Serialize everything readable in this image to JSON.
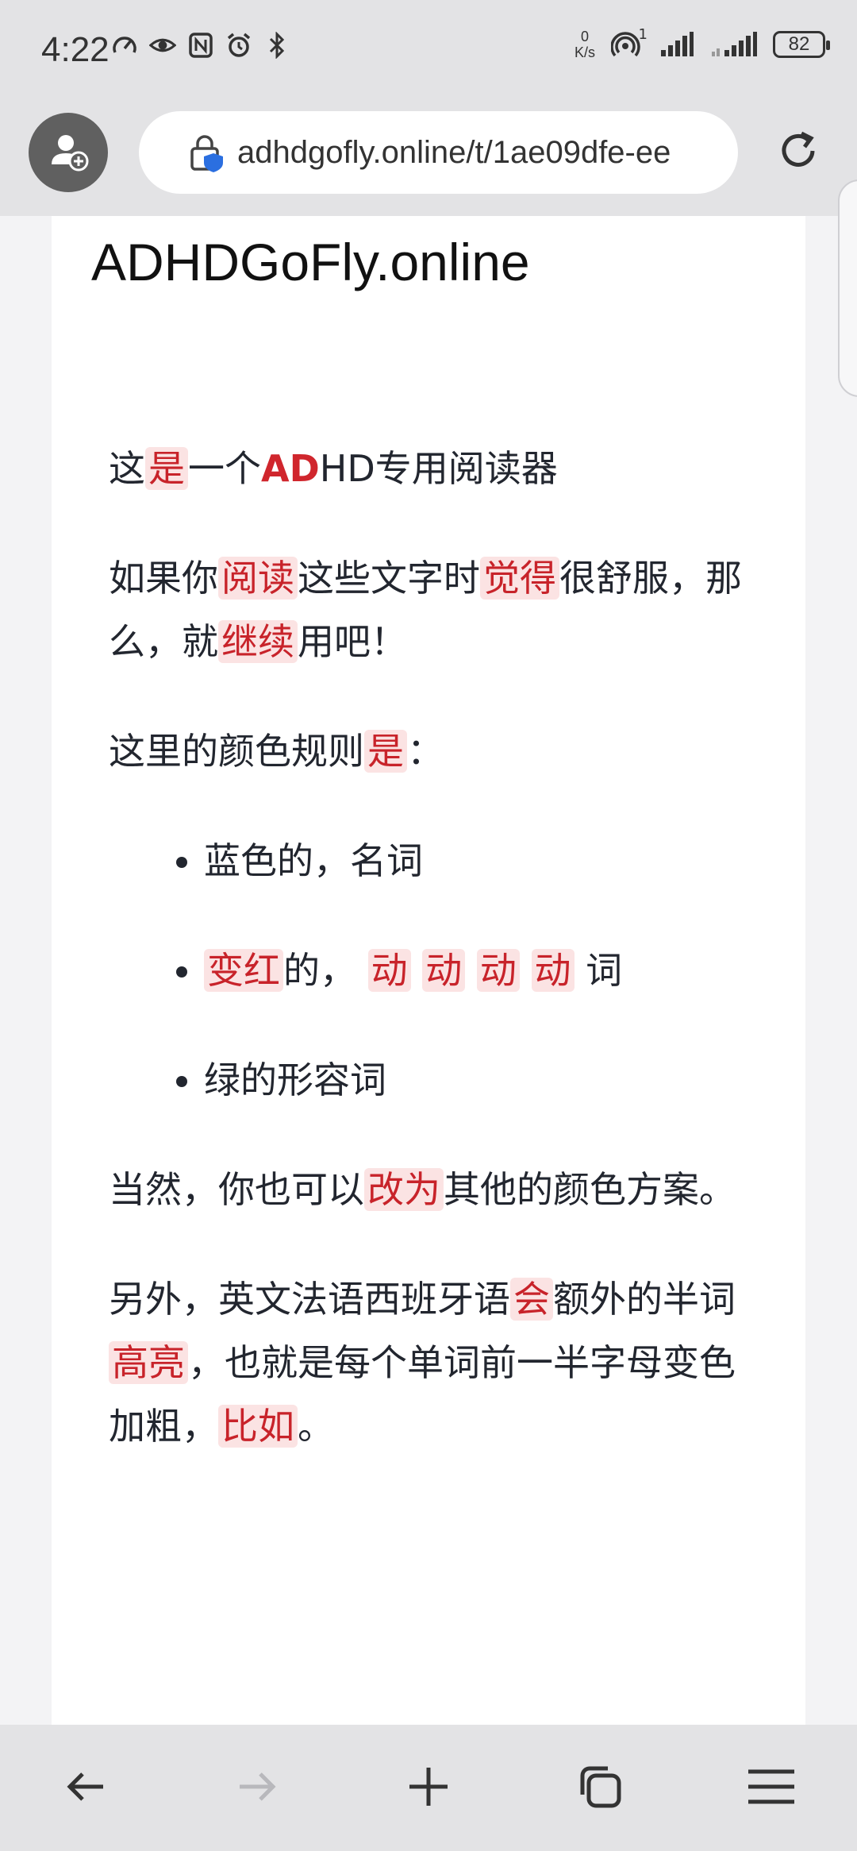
{
  "status_bar": {
    "time": "4:22",
    "net_speed_value": "0",
    "net_speed_unit": "K/s",
    "hotspot_badge": "1",
    "battery": "82"
  },
  "browser": {
    "url": "adhdgofly.online/t/1ae09dfe-ee"
  },
  "page": {
    "site_title": "ADHDGoFly.online",
    "p1": {
      "a": "这",
      "b": "是",
      "c": "一个",
      "d": "AD",
      "e": "HD专用阅读器"
    },
    "p2": {
      "a": "如果你",
      "b": "阅读",
      "c": "这些文字时",
      "d": "觉得",
      "e": "很舒服，那么，就",
      "f": "继续",
      "g": "用吧！"
    },
    "p3": {
      "a": "这里的颜色规则",
      "b": "是",
      "c": "："
    },
    "list": {
      "item1": "蓝色的，名词",
      "item2": {
        "a": "变红",
        "b": "的，",
        "c": "动",
        "d": "动",
        "e": "动",
        "f": "动",
        "g": "词"
      },
      "item3": "绿的形容词"
    },
    "p4": {
      "a": "当然，你也可以",
      "b": "改为",
      "c": "其他的颜色方案。"
    },
    "p5": {
      "a": "另外，英文法语西班牙语",
      "b": "会",
      "c": "额外的半词",
      "d": "高亮",
      "e": "，也就是每个单词前一半字母变色加粗，",
      "f": "比如",
      "g": "。"
    }
  },
  "colors": {
    "highlight_bg": "#fbe3e3",
    "highlight_text": "#c8232a",
    "bar_bg": "#e3e3e5"
  },
  "icons": {
    "profile": "add-profile-icon",
    "lock": "site-security-icon",
    "reload": "reload-icon",
    "back": "back-arrow-icon",
    "forward": "forward-arrow-icon",
    "new_tab": "plus-icon",
    "tabs": "tabs-icon",
    "menu": "menu-icon"
  }
}
